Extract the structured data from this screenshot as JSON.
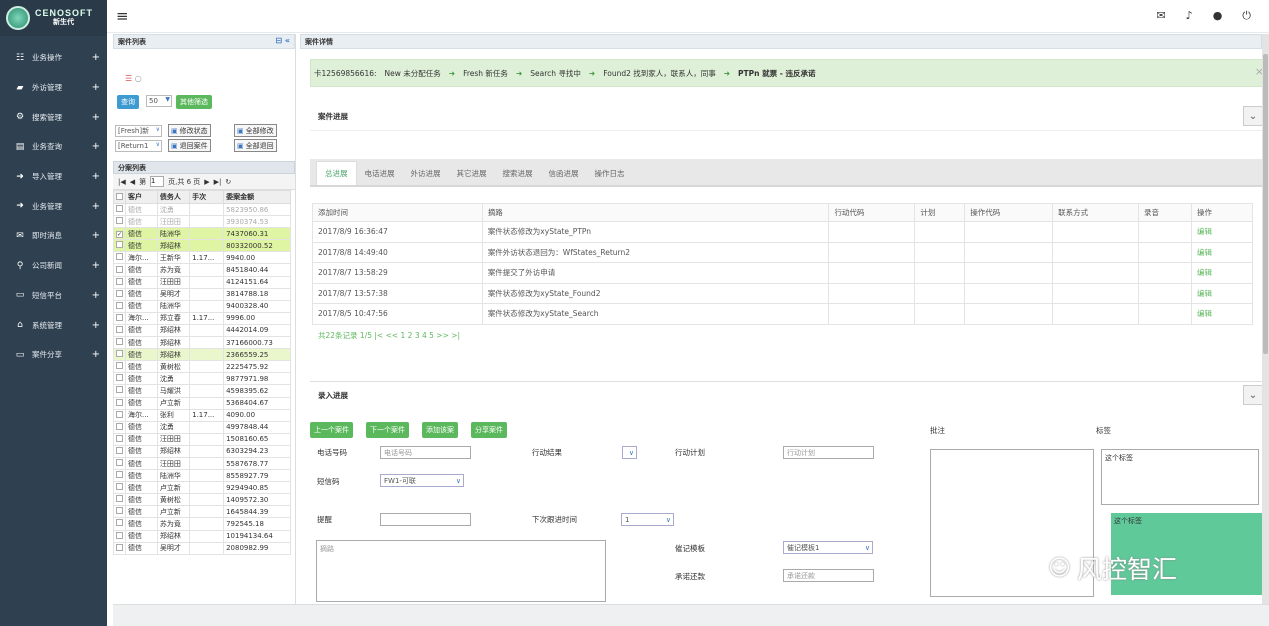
{
  "app": {
    "logo_en": "CENOSOFT",
    "logo_cn": "新生代"
  },
  "sidebar": {
    "items": [
      {
        "label": "业务操作",
        "icon": "table-icon",
        "glyph": "☷"
      },
      {
        "label": "外访管理",
        "icon": "car-icon",
        "glyph": "▰"
      },
      {
        "label": "搜索管理",
        "icon": "cogs-icon",
        "glyph": "⚙"
      },
      {
        "label": "业务查询",
        "icon": "chart-icon",
        "glyph": "▤"
      },
      {
        "label": "导入管理",
        "icon": "sign-in-icon",
        "glyph": "➜"
      },
      {
        "label": "业务管理",
        "icon": "sign-in-icon",
        "glyph": "➜"
      },
      {
        "label": "即时消息",
        "icon": "envelope-icon",
        "glyph": "✉"
      },
      {
        "label": "公司新闻",
        "icon": "map-marker-icon",
        "glyph": "⚲"
      },
      {
        "label": "短信平台",
        "icon": "laptop-icon",
        "glyph": "▭"
      },
      {
        "label": "系统管理",
        "icon": "home-icon",
        "glyph": "⌂"
      },
      {
        "label": "案件分享",
        "icon": "laptop-icon",
        "glyph": "▭"
      }
    ],
    "plus": "+"
  },
  "topbar": {
    "menu_glyph": "≡",
    "mail_glyph": "✉",
    "bell_glyph": "♪",
    "user_glyph": "●",
    "power_glyph": "⏻"
  },
  "left": {
    "title": "案件列表",
    "query_btn": "查询",
    "page_size": "50",
    "other_filter_btn": "其他筛选",
    "status_select": "[Fresh]新",
    "return_select": "[Return1",
    "modify_status_btn": "修改状态",
    "modify_all_btn": "全部修改",
    "return_case_btn": "退回案件",
    "return_all_btn": "全部退回",
    "split_title": "分案列表",
    "pager": {
      "page_label": "第",
      "page": "1",
      "total": "页,共 6 页"
    },
    "columns": [
      "客户",
      "债务人",
      "手次",
      "委案金额"
    ],
    "rows": [
      {
        "client": "德信",
        "debtor": "沈勇",
        "times": "",
        "amount": "5823950.86",
        "style": "gray",
        "checked": false
      },
      {
        "client": "德信",
        "debtor": "汪田田",
        "times": "",
        "amount": "3930374.53",
        "style": "gray",
        "checked": false
      },
      {
        "client": "德信",
        "debtor": "陆洲华",
        "times": "",
        "amount": "7437060.31",
        "style": "hl",
        "checked": true
      },
      {
        "client": "德信",
        "debtor": "郑绍林",
        "times": "",
        "amount": "80332000.52",
        "style": "hl",
        "checked": false
      },
      {
        "client": "海尔...",
        "debtor": "王新华",
        "times": "1.17...",
        "amount": "9940.00",
        "style": "",
        "checked": false
      },
      {
        "client": "德信",
        "debtor": "苏为竟",
        "times": "",
        "amount": "8451840.44",
        "style": "",
        "checked": false
      },
      {
        "client": "德信",
        "debtor": "汪田田",
        "times": "",
        "amount": "4124151.64",
        "style": "",
        "checked": false
      },
      {
        "client": "德信",
        "debtor": "吴明才",
        "times": "",
        "amount": "3814788.18",
        "style": "",
        "checked": false
      },
      {
        "client": "德信",
        "debtor": "陆洲华",
        "times": "",
        "amount": "9400328.40",
        "style": "",
        "checked": false
      },
      {
        "client": "海尔...",
        "debtor": "郑立春",
        "times": "1.17...",
        "amount": "9996.00",
        "style": "",
        "checked": false
      },
      {
        "client": "德信",
        "debtor": "郑绍林",
        "times": "",
        "amount": "4442014.09",
        "style": "",
        "checked": false
      },
      {
        "client": "德信",
        "debtor": "郑绍林",
        "times": "",
        "amount": "37166000.73",
        "style": "",
        "checked": false
      },
      {
        "client": "德信",
        "debtor": "郑绍林",
        "times": "",
        "amount": "2366559.25",
        "style": "hl2",
        "checked": false
      },
      {
        "client": "德信",
        "debtor": "黄树松",
        "times": "",
        "amount": "2225475.92",
        "style": "",
        "checked": false
      },
      {
        "client": "德信",
        "debtor": "沈勇",
        "times": "",
        "amount": "9877971.98",
        "style": "",
        "checked": false
      },
      {
        "client": "德信",
        "debtor": "马耀洪",
        "times": "",
        "amount": "4598395.62",
        "style": "",
        "checked": false
      },
      {
        "client": "德信",
        "debtor": "卢立新",
        "times": "",
        "amount": "5368404.67",
        "style": "",
        "checked": false
      },
      {
        "client": "海尔...",
        "debtor": "张利",
        "times": "1.17...",
        "amount": "4090.00",
        "style": "",
        "checked": false
      },
      {
        "client": "德信",
        "debtor": "沈勇",
        "times": "",
        "amount": "4997848.44",
        "style": "",
        "checked": false
      },
      {
        "client": "德信",
        "debtor": "汪田田",
        "times": "",
        "amount": "1508160.65",
        "style": "",
        "checked": false
      },
      {
        "client": "德信",
        "debtor": "郑绍林",
        "times": "",
        "amount": "6303294.23",
        "style": "",
        "checked": false
      },
      {
        "client": "德信",
        "debtor": "汪田田",
        "times": "",
        "amount": "5587678.77",
        "style": "",
        "checked": false
      },
      {
        "client": "德信",
        "debtor": "陆洲华",
        "times": "",
        "amount": "8558927.79",
        "style": "",
        "checked": false
      },
      {
        "client": "德信",
        "debtor": "卢立新",
        "times": "",
        "amount": "9294940.85",
        "style": "",
        "checked": false
      },
      {
        "client": "德信",
        "debtor": "黄树松",
        "times": "",
        "amount": "1409572.30",
        "style": "",
        "checked": false
      },
      {
        "client": "德信",
        "debtor": "卢立新",
        "times": "",
        "amount": "1645844.39",
        "style": "",
        "checked": false
      },
      {
        "client": "德信",
        "debtor": "苏为竟",
        "times": "",
        "amount": "792545.18",
        "style": "",
        "checked": false
      },
      {
        "client": "德信",
        "debtor": "郑绍林",
        "times": "",
        "amount": "10194134.64",
        "style": "",
        "checked": false
      },
      {
        "client": "德信",
        "debtor": "吴明才",
        "times": "",
        "amount": "2080982.99",
        "style": "",
        "checked": false
      }
    ]
  },
  "right": {
    "title": "案件详情",
    "flow": {
      "case": "卡12569856616:",
      "steps": [
        "New 未分配任务",
        "Fresh 新任务",
        "Search 寻找中",
        "Found2 找到家人，联系人，同事",
        "PTPn 就票 - 违反承诺"
      ],
      "arrow": "➜",
      "close": "×"
    },
    "progress_title": "案件进展",
    "tabs": [
      "总进展",
      "电话进展",
      "外访进展",
      "其它进展",
      "搜索进展",
      "信函进展",
      "操作日志"
    ],
    "table": {
      "columns": [
        "添加时间",
        "摘路",
        "行动代码",
        "计划",
        "操作代码",
        "联系方式",
        "录音",
        "操作"
      ],
      "rows": [
        {
          "time": "2017/8/9 16:36:47",
          "note": "案件状态修改为xyState_PTPn",
          "op": "编辑"
        },
        {
          "time": "2017/8/8 14:49:40",
          "note": "案件外访状态退回为：WfStates_Return2",
          "op": "编辑"
        },
        {
          "time": "2017/8/7 13:58:29",
          "note": "案件提交了外访申请",
          "op": "编辑"
        },
        {
          "time": "2017/8/7 13:57:38",
          "note": "案件状态修改为xyState_Found2",
          "op": "编辑"
        },
        {
          "time": "2017/8/5 10:47:56",
          "note": "案件状态修改为xyState_Search",
          "op": "编辑"
        }
      ],
      "pager": "共22条记录 1/5 |< << 1 2 3 4 5 >> >|"
    },
    "entry_title": "录入进展",
    "entry": {
      "prev_btn": "上一个案件",
      "next_btn": "下一个案件",
      "add_btn": "添加该案",
      "share_btn": "分享案件",
      "phone_label": "电话号码",
      "phone_placeholder": "电话号码",
      "action_result_label": "行动结果",
      "action_plan_label": "行动计划",
      "action_plan_placeholder": "行动计划",
      "sms_label": "短信码",
      "sms_value": "FW1-可联",
      "remind_label": "提醒",
      "next_time_label": "下次跟进时间",
      "next_time_value": "1",
      "memo_placeholder": "摘路",
      "template_label": "催记模板",
      "template_value": "催记模板1",
      "promise_label": "承诺还款",
      "promise_placeholder": "承诺还款",
      "note_label": "批注",
      "tag_label": "标签",
      "tag_text1": "这个标签",
      "tag_text2": "这个标签"
    },
    "collapse_glyph": "⌄"
  },
  "watermark": {
    "text": "风控智汇",
    "glyph": "☺"
  }
}
